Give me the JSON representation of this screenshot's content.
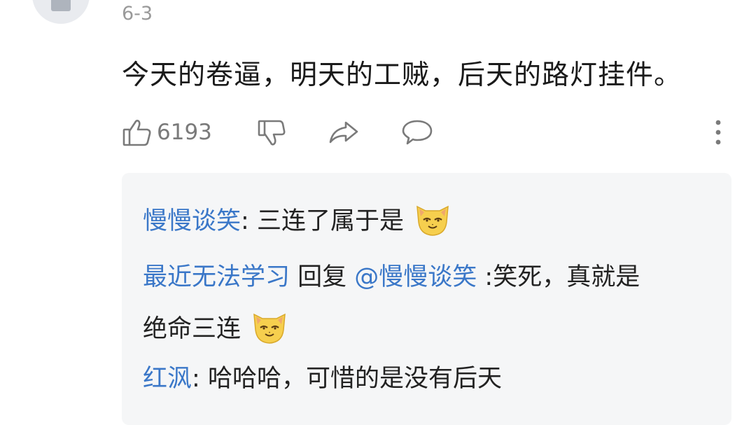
{
  "comment": {
    "date": "6-3",
    "text": "今天的卷逼，明天的工贼，后天的路灯挂件。",
    "like_count": "6193",
    "icons": {
      "like": "thumb-up-icon",
      "dislike": "thumb-down-icon",
      "share": "share-icon",
      "reply": "comment-bubble-icon",
      "more": "more-vertical-icon"
    }
  },
  "replies": [
    {
      "user": "慢慢谈笑",
      "separator": ":",
      "text": " 三连了属于是",
      "emoji": "cat-emoji"
    },
    {
      "user": "最近无法学习",
      "reply_word": " 回复 ",
      "mention": "@慢慢谈笑",
      "text_line1": " :笑死，真就是",
      "text_line2": "绝命三连",
      "emoji": "cat-emoji"
    },
    {
      "user": "红沨",
      "separator": ":",
      "text": " 哈哈哈，可惜的是没有后天"
    }
  ],
  "colors": {
    "username": "#3a77c8",
    "text": "#1a1a1a",
    "muted": "#999999",
    "reply_bg": "#f5f6f7",
    "emoji_face": "#f6cf4e"
  }
}
